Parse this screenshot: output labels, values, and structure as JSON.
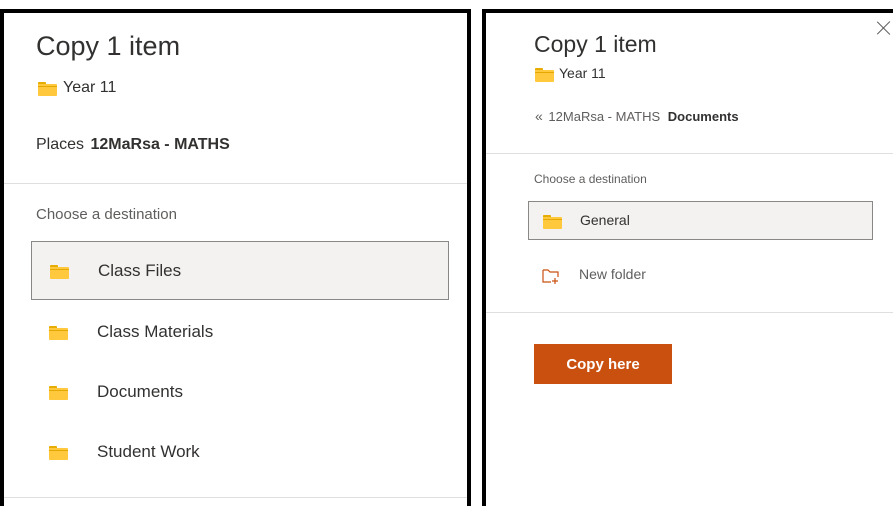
{
  "left_panel": {
    "title": "Copy 1 item",
    "source_folder": "Year 11",
    "places_label": "Places",
    "places_value": "12MaRsa - MATHS",
    "choose_label": "Choose a destination",
    "items": [
      {
        "label": "Class Files",
        "icon": "folder-icon",
        "selected": true
      },
      {
        "label": "Class Materials",
        "icon": "folder-icon",
        "selected": false
      },
      {
        "label": "Documents",
        "icon": "folder-icon",
        "selected": false
      },
      {
        "label": "Student Work",
        "icon": "folder-icon",
        "selected": false
      }
    ]
  },
  "right_panel": {
    "title": "Copy 1 item",
    "source_folder": "Year 11",
    "back_icon": "double-chevron-left-icon",
    "breadcrumb_parent": "12MaRsa - MATHS",
    "breadcrumb_current": "Documents",
    "choose_label": "Choose a destination",
    "items": [
      {
        "label": "General",
        "icon": "folder-icon",
        "selected": true
      }
    ],
    "new_folder_label": "New folder",
    "new_folder_icon": "new-folder-icon",
    "copy_button": "Copy here",
    "close_icon": "close-icon"
  },
  "colors": {
    "accent_button": "#ca5010",
    "folder": "#ffc83d",
    "selection_border": "#8a8886"
  }
}
